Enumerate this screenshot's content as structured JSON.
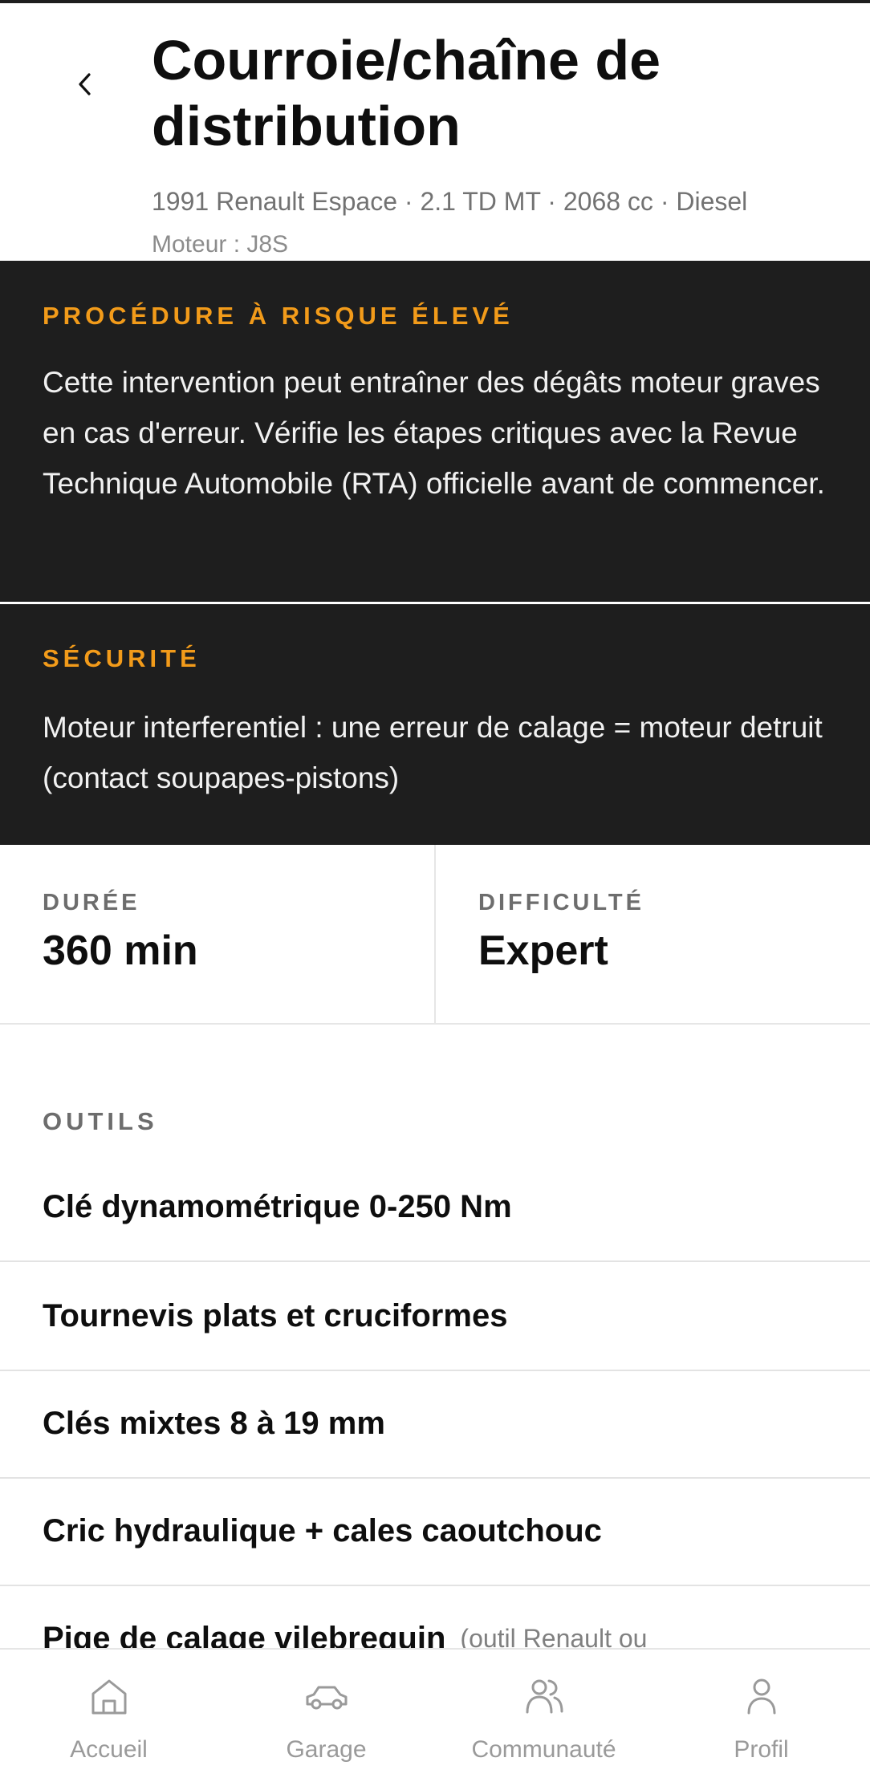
{
  "header": {
    "title": "Courroie/chaîne de distribution",
    "vehicle": "1991 Renault Espace · 2.1 TD MT · 2068 cc · Diesel",
    "engine": "Moteur : J8S"
  },
  "risk_banner": {
    "heading": "PROCÉDURE À RISQUE ÉLEVÉ",
    "text": "Cette intervention peut entraîner des dégâts moteur graves en cas d'erreur. Vérifie les étapes critiques avec la Revue Technique Automobile (RTA) officielle avant de commencer."
  },
  "safety_banner": {
    "heading": "SÉCURITÉ",
    "text": "Moteur interferentiel : une erreur de calage = moteur detruit (contact soupapes-pistons)"
  },
  "stats": {
    "duration_label": "DURÉE",
    "duration_value": "360 min",
    "difficulty_label": "DIFFICULTÉ",
    "difficulty_value": "Expert"
  },
  "tools": {
    "heading": "OUTILS",
    "items": [
      {
        "name": "Clé dynamométrique 0-250 Nm",
        "note": ""
      },
      {
        "name": "Tournevis plats et cruciformes",
        "note": ""
      },
      {
        "name": "Clés mixtes 8 à 19 mm",
        "note": ""
      },
      {
        "name": "Cric hydraulique + cales caoutchouc",
        "note": ""
      },
      {
        "name": "Pige de calage vilebrequin",
        "note": "(outil Renault ou"
      }
    ]
  },
  "nav": {
    "items": [
      {
        "label": "Accueil",
        "icon": "home-icon"
      },
      {
        "label": "Garage",
        "icon": "car-icon"
      },
      {
        "label": "Communauté",
        "icon": "community-icon"
      },
      {
        "label": "Profil",
        "icon": "profile-icon"
      }
    ]
  },
  "colors": {
    "accent": "#f29b1a",
    "banner_bg": "#1e1e1e",
    "text": "#0e0e0e",
    "muted": "#9a9a9a"
  }
}
